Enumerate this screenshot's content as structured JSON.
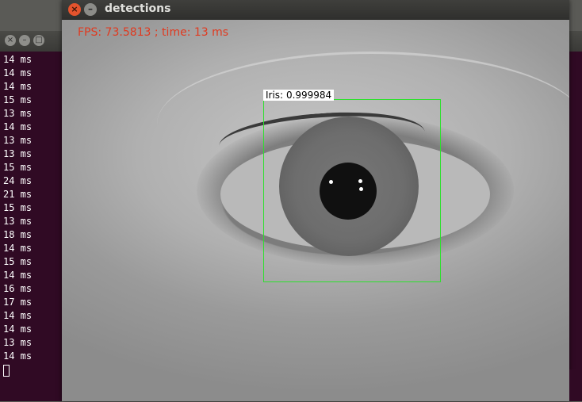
{
  "terminal": {
    "lines": [
      "14 ms",
      "14 ms",
      "14 ms",
      "15 ms",
      "13 ms",
      "14 ms",
      "13 ms",
      "13 ms",
      "15 ms",
      "24 ms",
      "21 ms",
      "15 ms",
      "13 ms",
      "18 ms",
      "14 ms",
      "15 ms",
      "14 ms",
      "16 ms",
      "17 ms",
      "14 ms",
      "14 ms",
      "13 ms",
      "14 ms"
    ]
  },
  "detections_window": {
    "title": "detections",
    "overlay_text": "FPS: 73.5813 ; time: 13 ms",
    "detection": {
      "label": "Iris:",
      "score": "0.999984"
    },
    "colors": {
      "overlay_text": "#e03a20",
      "bbox": "#2ee02e",
      "close_button": "#e5532d"
    }
  }
}
